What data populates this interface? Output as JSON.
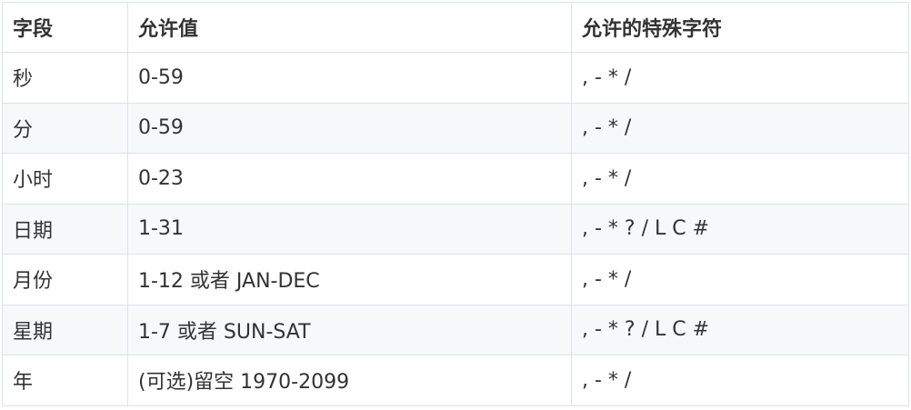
{
  "table": {
    "headers": [
      "字段",
      "允许值",
      "允许的特殊字符"
    ],
    "rows": [
      [
        "秒",
        "0-59",
        ", - * /"
      ],
      [
        "分",
        "0-59",
        ", - * /"
      ],
      [
        "小时",
        "0-23",
        ", - * /"
      ],
      [
        "日期",
        "1-31",
        ", - * ? / L C #"
      ],
      [
        "月份",
        "1-12 或者 JAN-DEC",
        ", - * /"
      ],
      [
        "星期",
        "1-7 或者 SUN-SAT",
        ", - * ? / L C #"
      ],
      [
        "年",
        "(可选)留空 1970-2099",
        ", - * /"
      ]
    ]
  }
}
